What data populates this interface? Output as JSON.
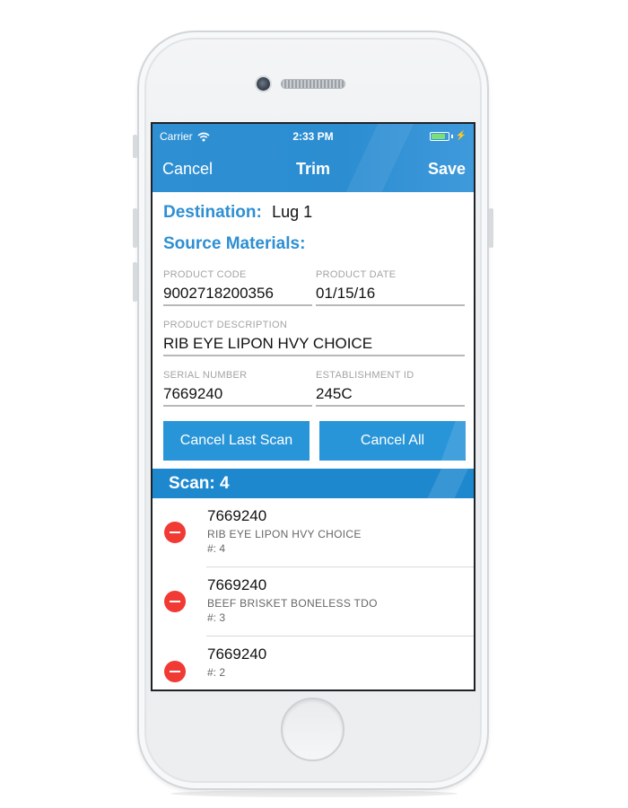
{
  "status_bar": {
    "carrier": "Carrier",
    "time": "2:33 PM",
    "battery_level": 0.85
  },
  "nav": {
    "cancel_label": "Cancel",
    "title": "Trim",
    "save_label": "Save"
  },
  "destination": {
    "label": "Destination:",
    "value": "Lug 1"
  },
  "source_title": "Source Materials:",
  "fields": {
    "product_code": {
      "label": "PRODUCT CODE",
      "value": "9002718200356"
    },
    "product_date": {
      "label": "PRODUCT DATE",
      "value": "01/15/16"
    },
    "product_description": {
      "label": "PRODUCT DESCRIPTION",
      "value": "RIB EYE LIPON HVY CHOICE"
    },
    "serial_number": {
      "label": "SERIAL NUMBER",
      "value": "7669240"
    },
    "establishment_id": {
      "label": "ESTABLISHMENT ID",
      "value": "245C"
    }
  },
  "buttons": {
    "cancel_last_scan": "Cancel Last Scan",
    "cancel_all": "Cancel All"
  },
  "scan": {
    "label": "Scan: 4"
  },
  "scans": [
    {
      "serial": "7669240",
      "description": "RIB EYE LIPON HVY CHOICE",
      "count": "#: 4"
    },
    {
      "serial": "7669240",
      "description": "BEEF BRISKET BONELESS TDO",
      "count": "#: 3"
    },
    {
      "serial": "7669240",
      "description": "",
      "count": "#: 2"
    }
  ],
  "colors": {
    "accent": "#2e8fd3",
    "button": "#2895d8",
    "scan_bar": "#1e88cf",
    "remove": "#f03a33"
  }
}
